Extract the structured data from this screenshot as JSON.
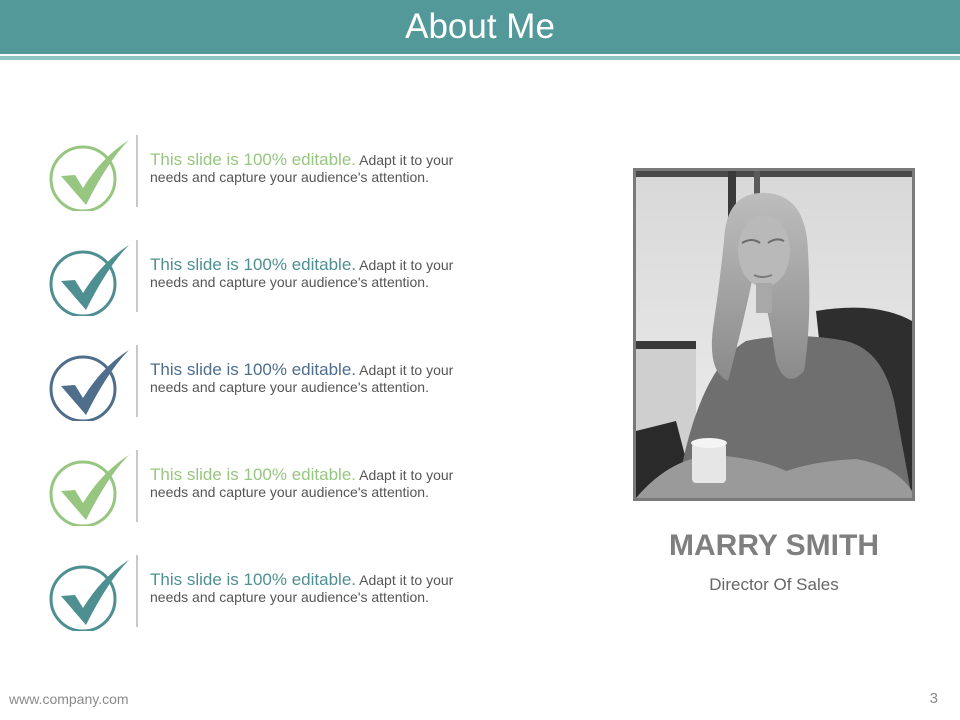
{
  "header": {
    "title": "About Me"
  },
  "items": [
    {
      "heading": "This slide is 100% editable.",
      "body": " Adapt it to your needs and capture your audience's attention.",
      "color": "#96c67f"
    },
    {
      "heading": "This slide is 100% editable.",
      "body": " Adapt it to your needs and capture your audience's attention.",
      "color": "#4e8f92"
    },
    {
      "heading": "This slide is 100% editable.",
      "body": " Adapt it to your needs and capture your audience's attention.",
      "color": "#4e6e8c"
    },
    {
      "heading": "This slide is 100% editable.",
      "body": " Adapt it to your needs and capture your audience's attention.",
      "color": "#96c67f"
    },
    {
      "heading": "This slide is 100% editable.",
      "body": " Adapt it to your needs and capture your audience's attention.",
      "color": "#4e8f92"
    }
  ],
  "profile": {
    "name": "MARRY SMITH",
    "role": "Director Of Sales"
  },
  "footer": {
    "url": "www.company.com",
    "page": "3"
  },
  "colors": {
    "title_bar": "#53999a",
    "title_rule": "#8ec5c2"
  }
}
